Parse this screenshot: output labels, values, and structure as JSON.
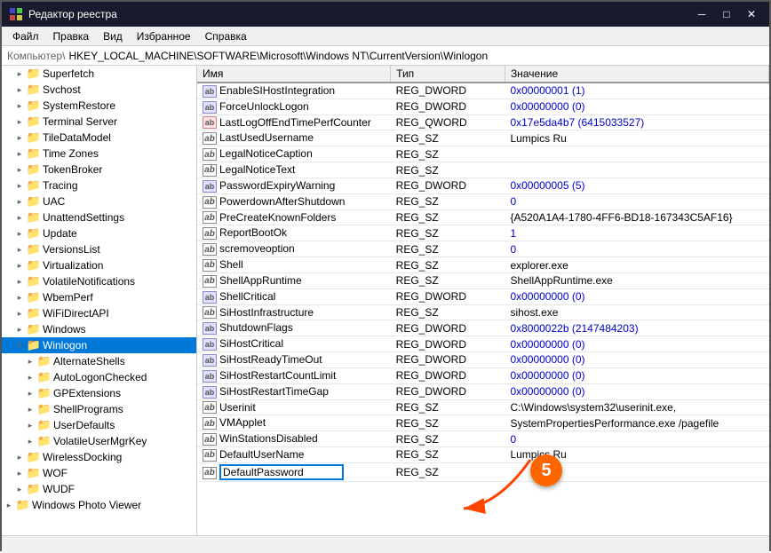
{
  "window": {
    "title": "Редактор реестра",
    "address": "Компьютер\\HKEY_LOCAL_MACHINE\\SOFTWARE\\Microsoft\\Windows NT\\CurrentVersion\\Winlogon"
  },
  "menu": {
    "items": [
      "Файл",
      "Правка",
      "Вид",
      "Избранное",
      "Справка"
    ]
  },
  "sidebar": {
    "items": [
      {
        "id": "superfetch",
        "label": "Superfetch",
        "level": 1,
        "expanded": false
      },
      {
        "id": "svchost",
        "label": "Svchost",
        "level": 1,
        "expanded": false
      },
      {
        "id": "systemrestore",
        "label": "SystemRestore",
        "level": 1,
        "expanded": false
      },
      {
        "id": "terminalserver",
        "label": "Terminal Server",
        "level": 1,
        "expanded": false
      },
      {
        "id": "tiledatamodel",
        "label": "TileDataModel",
        "level": 1,
        "expanded": false
      },
      {
        "id": "timezones",
        "label": "Time Zones",
        "level": 1,
        "expanded": false
      },
      {
        "id": "tokenbroker",
        "label": "TokenBroker",
        "level": 1,
        "expanded": false
      },
      {
        "id": "tracing",
        "label": "Tracing",
        "level": 1,
        "expanded": false
      },
      {
        "id": "uac",
        "label": "UAC",
        "level": 1,
        "expanded": false
      },
      {
        "id": "unattendsettings",
        "label": "UnattendSettings",
        "level": 1,
        "expanded": false
      },
      {
        "id": "update",
        "label": "Update",
        "level": 1,
        "expanded": false
      },
      {
        "id": "versionslist",
        "label": "VersionsList",
        "level": 1,
        "expanded": false
      },
      {
        "id": "virtualization",
        "label": "Virtualization",
        "level": 1,
        "expanded": false
      },
      {
        "id": "volatilenotifications",
        "label": "VolatileNotifications",
        "level": 1,
        "expanded": false
      },
      {
        "id": "wbemperf",
        "label": "WbemPerf",
        "level": 1,
        "expanded": false
      },
      {
        "id": "wifidirectapi",
        "label": "WiFiDirectAPI",
        "level": 1,
        "expanded": false
      },
      {
        "id": "windows",
        "label": "Windows",
        "level": 1,
        "expanded": false
      },
      {
        "id": "winlogon",
        "label": "Winlogon",
        "level": 1,
        "expanded": true,
        "selected": true
      },
      {
        "id": "alternateshells",
        "label": "AlternateShells",
        "level": 2,
        "expanded": false
      },
      {
        "id": "autologonchecked",
        "label": "AutoLogonChecked",
        "level": 2,
        "expanded": false
      },
      {
        "id": "gpextensions",
        "label": "GPExtensions",
        "level": 2,
        "expanded": false
      },
      {
        "id": "shellprograms",
        "label": "ShellPrograms",
        "level": 2,
        "expanded": false
      },
      {
        "id": "userdefaults",
        "label": "UserDefaults",
        "level": 2,
        "expanded": false
      },
      {
        "id": "volatileusermgrkey",
        "label": "VolatileUserMgrKey",
        "level": 2,
        "expanded": false
      },
      {
        "id": "wirelessdocking",
        "label": "WirelessDocking",
        "level": 1,
        "expanded": false
      },
      {
        "id": "wof",
        "label": "WOF",
        "level": 1,
        "expanded": false
      },
      {
        "id": "wudf",
        "label": "WUDF",
        "level": 1,
        "expanded": false
      },
      {
        "id": "windowsphotoviewer",
        "label": "Windows Photo Viewer",
        "level": 0,
        "expanded": false
      }
    ]
  },
  "table": {
    "columns": [
      "Имя",
      "Тип",
      "Значение"
    ],
    "rows": [
      {
        "name": "EnableSIHostIntegration",
        "type": "REG_DWORD",
        "value": "0x00000001 (1)",
        "icon": "dword"
      },
      {
        "name": "ForceUnlockLogon",
        "type": "REG_DWORD",
        "value": "0x00000000 (0)",
        "icon": "dword"
      },
      {
        "name": "LastLogOffEndTimePerfCounter",
        "type": "REG_QWORD",
        "value": "0x17e5da4b7 (6415033527)",
        "icon": "qword"
      },
      {
        "name": "LastUsedUsername",
        "type": "REG_SZ",
        "value": "Lumpics Ru",
        "icon": "sz"
      },
      {
        "name": "LegalNoticeCaption",
        "type": "REG_SZ",
        "value": "",
        "icon": "sz"
      },
      {
        "name": "LegalNoticeText",
        "type": "REG_SZ",
        "value": "",
        "icon": "sz"
      },
      {
        "name": "PasswordExpiryWarning",
        "type": "REG_DWORD",
        "value": "0x00000005 (5)",
        "icon": "dword"
      },
      {
        "name": "PowerdownAfterShutdown",
        "type": "REG_SZ",
        "value": "0",
        "icon": "sz"
      },
      {
        "name": "PreCreateKnownFolders",
        "type": "REG_SZ",
        "value": "{A520A1A4-1780-4FF6-BD18-167343C5AF16}",
        "icon": "sz"
      },
      {
        "name": "ReportBootOk",
        "type": "REG_SZ",
        "value": "1",
        "icon": "sz"
      },
      {
        "name": "scremoveoption",
        "type": "REG_SZ",
        "value": "0",
        "icon": "sz"
      },
      {
        "name": "Shell",
        "type": "REG_SZ",
        "value": "explorer.exe",
        "icon": "sz"
      },
      {
        "name": "ShellAppRuntime",
        "type": "REG_SZ",
        "value": "ShellAppRuntime.exe",
        "icon": "sz"
      },
      {
        "name": "ShellCritical",
        "type": "REG_DWORD",
        "value": "0x00000000 (0)",
        "icon": "dword"
      },
      {
        "name": "SiHostInfrastructure",
        "type": "REG_SZ",
        "value": "sihost.exe",
        "icon": "sz"
      },
      {
        "name": "ShutdownFlags",
        "type": "REG_DWORD",
        "value": "0x8000022b (2147484203)",
        "icon": "dword"
      },
      {
        "name": "SiHostCritical",
        "type": "REG_DWORD",
        "value": "0x00000000 (0)",
        "icon": "dword"
      },
      {
        "name": "SiHostReadyTimeOut",
        "type": "REG_DWORD",
        "value": "0x00000000 (0)",
        "icon": "dword"
      },
      {
        "name": "SiHostRestartCountLimit",
        "type": "REG_DWORD",
        "value": "0x00000000 (0)",
        "icon": "dword"
      },
      {
        "name": "SiHostRestartTimeGap",
        "type": "REG_DWORD",
        "value": "0x00000000 (0)",
        "icon": "dword"
      },
      {
        "name": "Userinit",
        "type": "REG_SZ",
        "value": "C:\\Windows\\system32\\userinit.exe,",
        "icon": "sz"
      },
      {
        "name": "VMApplet",
        "type": "REG_SZ",
        "value": "SystemPropertiesPerformance.exe /pagefile",
        "icon": "sz"
      },
      {
        "name": "WinStationsDisabled",
        "type": "REG_SZ",
        "value": "0",
        "icon": "sz"
      },
      {
        "name": "DefaultUserName",
        "type": "REG_SZ",
        "value": "Lumpics Ru",
        "icon": "sz"
      },
      {
        "name": "DefaultPassword",
        "type": "REG_SZ",
        "value": "",
        "icon": "sz",
        "editing": true
      }
    ]
  },
  "callout": {
    "number": "5"
  },
  "status": {
    "text": ""
  }
}
